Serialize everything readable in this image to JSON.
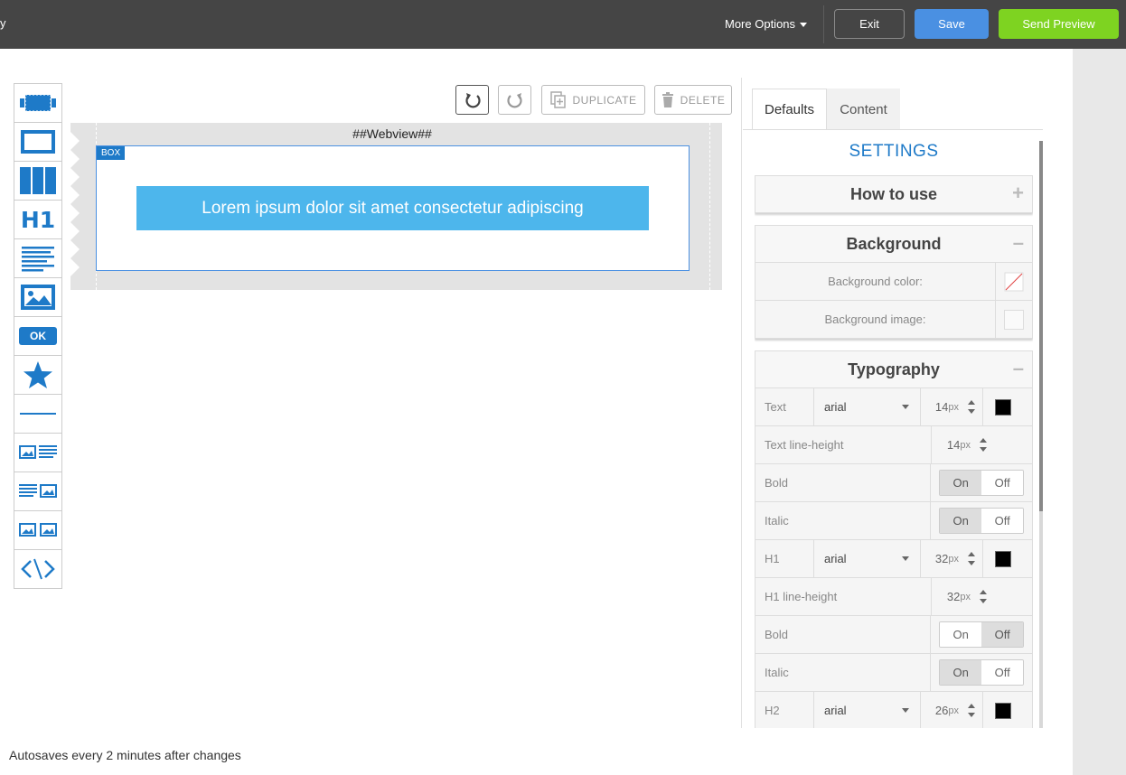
{
  "topbar": {
    "stub": "y",
    "more_options": "More Options",
    "exit": "Exit",
    "save": "Save",
    "send_preview": "Send Preview"
  },
  "palette": {
    "items": [
      "section-block-icon",
      "box-block-icon",
      "columns-block-icon",
      "h1-block-icon",
      "text-block-icon",
      "image-block-icon",
      "button-block-icon",
      "social-block-icon",
      "divider-block-icon",
      "image-text-block-icon",
      "text-image-block-icon",
      "image-image-block-icon",
      "code-block-icon"
    ],
    "h1_label": "H1",
    "ok_label": "OK"
  },
  "toolbar": {
    "duplicate": "DUPLICATE",
    "delete": "DELETE"
  },
  "canvas": {
    "webview": "##Webview##",
    "box_label": "BOX",
    "button_text": "Lorem ipsum dolor sit amet consectetur adipiscing"
  },
  "tabs": {
    "defaults": "Defaults",
    "content": "Content"
  },
  "settings": {
    "title": "SETTINGS",
    "how_to_use": "How to use",
    "background": {
      "title": "Background",
      "color_label": "Background color:",
      "image_label": "Background image:"
    },
    "typography": {
      "title": "Typography",
      "rows": {
        "text": {
          "label": "Text",
          "font": "arial",
          "size": "14",
          "unit": "px",
          "color": "#000000"
        },
        "text_lh": {
          "label": "Text line-height",
          "size": "14",
          "unit": "px"
        },
        "text_bold": {
          "label": "Bold",
          "on": "On",
          "off": "Off",
          "value": "On"
        },
        "text_italic": {
          "label": "Italic",
          "on": "On",
          "off": "Off",
          "value": "On"
        },
        "h1": {
          "label": "H1",
          "font": "arial",
          "size": "32",
          "unit": "px",
          "color": "#000000"
        },
        "h1_lh": {
          "label": "H1 line-height",
          "size": "32",
          "unit": "px"
        },
        "h1_bold": {
          "label": "Bold",
          "on": "On",
          "off": "Off",
          "value": "Off"
        },
        "h1_italic": {
          "label": "Italic",
          "on": "On",
          "off": "Off",
          "value": "On"
        },
        "h2": {
          "label": "H2",
          "font": "arial",
          "size": "26",
          "unit": "px",
          "color": "#000000"
        }
      }
    }
  },
  "footer": {
    "autosave": "Autosaves every 2 minutes after changes"
  }
}
